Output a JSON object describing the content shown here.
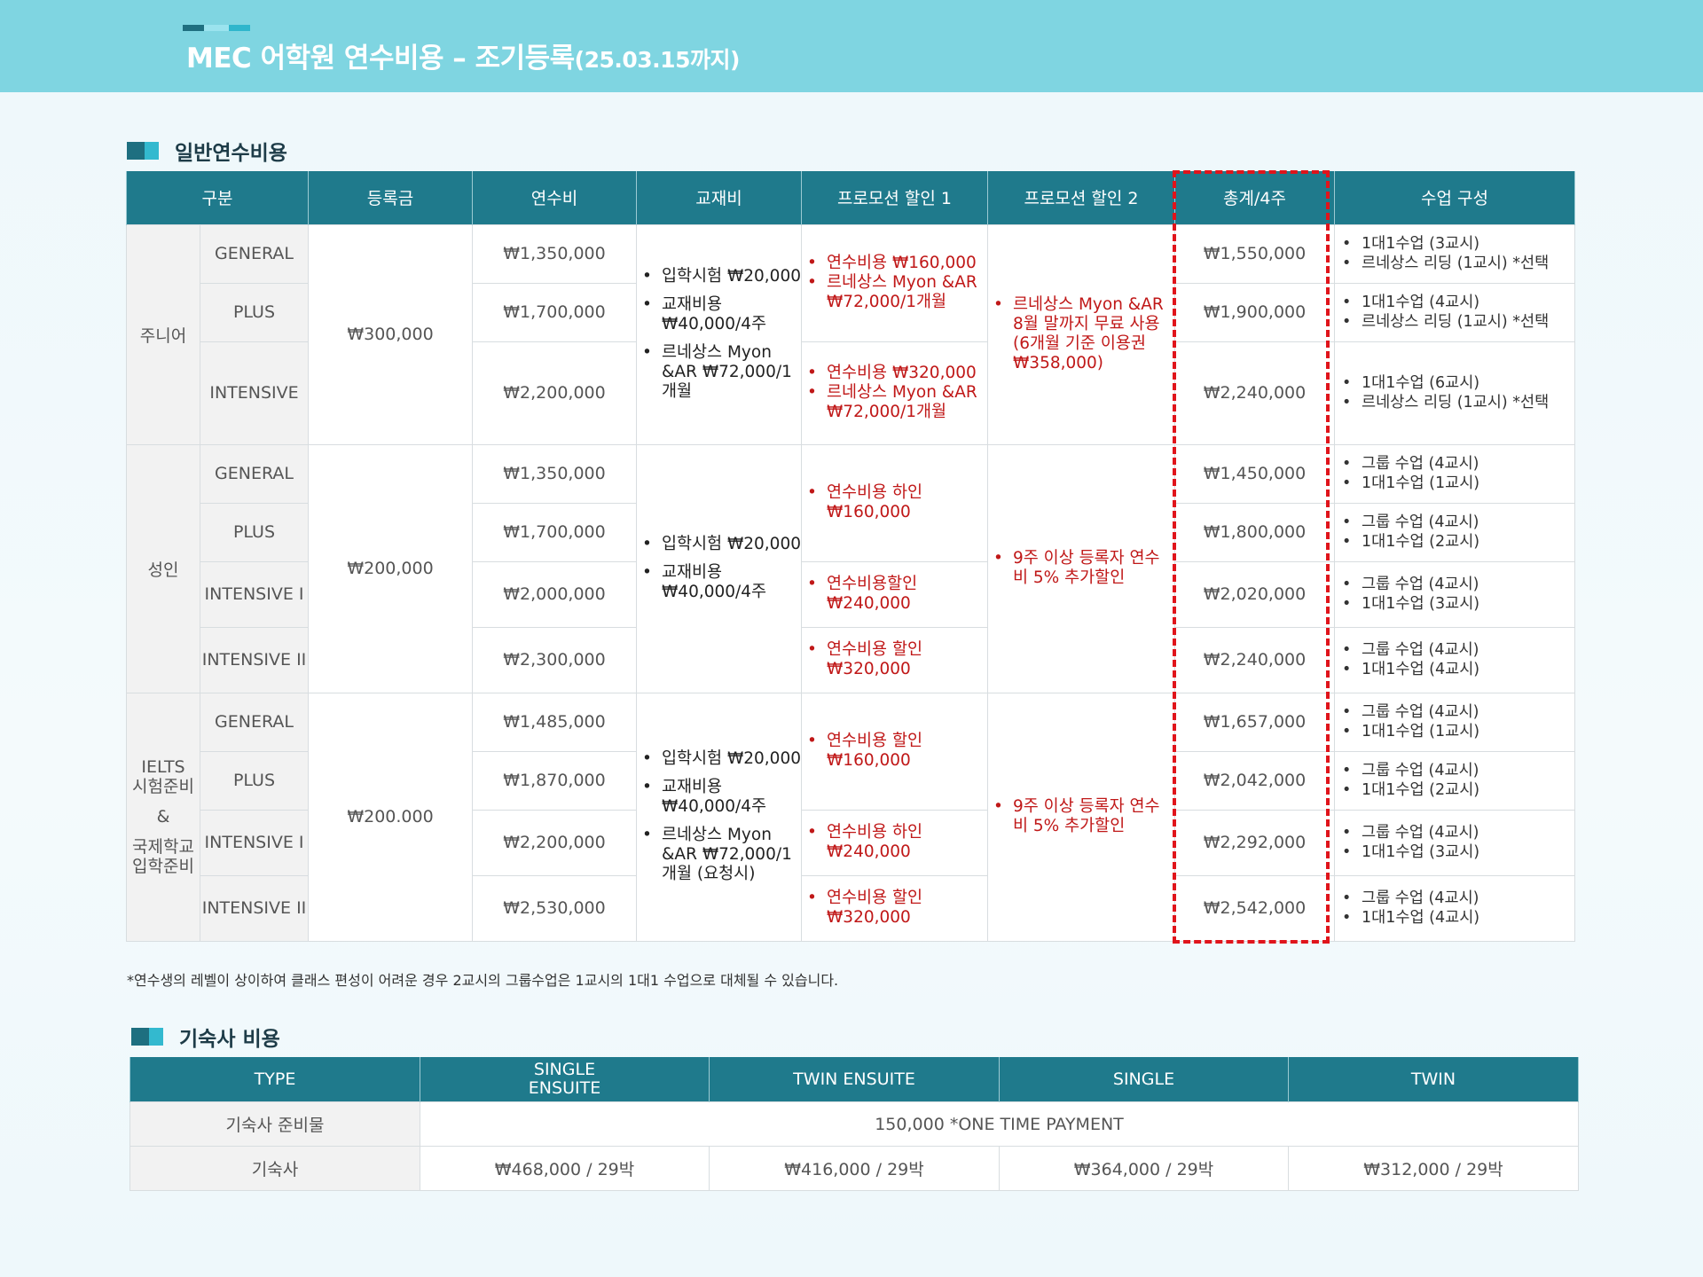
{
  "header": {
    "title_main": "MEC 어학원 연수비용 – 조기등록",
    "title_small": "(25.03.15까지)"
  },
  "colors": {
    "header_band": "#7fd5e1",
    "table_header": "#1f7a8c",
    "promo_text": "#c01818",
    "highlight_border": "#e0141b"
  },
  "section1": {
    "title": "일반연수비용",
    "headers": [
      "구분",
      "등록금",
      "연수비",
      "교재비",
      "프로모션 할인 1",
      "프로모션 할인 2",
      "총계/4주",
      "수업 구성"
    ],
    "groups": [
      {
        "category": "주니어",
        "registration": "₩300,000",
        "books": [
          "입학시험 ₩20,000",
          "교재비용 ₩40,000/4주",
          "르네상스 Myon &AR ₩72,000/1개월"
        ],
        "promo2": [
          "르네상스 Myon &AR 8월 말까지 무료 사용 (6개월 기준 이용권 ₩358,000)"
        ],
        "rows": [
          {
            "level": "GENERAL",
            "tuition": "₩1,350,000",
            "total": "₩1,550,000",
            "classes": [
              "1대1수업 (3교시)",
              "르네상스 리딩 (1교시) *선택"
            ]
          },
          {
            "level": "PLUS",
            "tuition": "₩1,700,000",
            "total": "₩1,900,000",
            "classes": [
              "1대1수업 (4교시)",
              "르네상스 리딩 (1교시) *선택"
            ]
          },
          {
            "level": "INTENSIVE",
            "tuition": "₩2,200,000",
            "total": "₩2,240,000",
            "classes": [
              "1대1수업 (6교시)",
              "르네상스 리딩 (1교시) *선택"
            ]
          }
        ],
        "promo1": [
          [
            "연수비용 ₩160,000",
            "르네상스 Myon &AR ₩72,000/1개월"
          ],
          [
            "연수비용 ₩320,000",
            "르네상스 Myon &AR ₩72,000/1개월"
          ]
        ]
      },
      {
        "category": "성인",
        "registration": "₩200,000",
        "books": [
          "입학시험 ₩20,000",
          "교재비용 ₩40,000/4주"
        ],
        "promo2": [
          "9주 이상 등록자 연수비 5% 추가할인"
        ],
        "rows": [
          {
            "level": "GENERAL",
            "tuition": "₩1,350,000",
            "total": "₩1,450,000",
            "classes": [
              "그룹 수업 (4교시)",
              "1대1수업 (1교시)"
            ]
          },
          {
            "level": "PLUS",
            "tuition": "₩1,700,000",
            "total": "₩1,800,000",
            "classes": [
              "그룹 수업 (4교시)",
              "1대1수업 (2교시)"
            ]
          },
          {
            "level": "INTENSIVE I",
            "tuition": "₩2,000,000",
            "total": "₩2,020,000",
            "classes": [
              "그룹 수업 (4교시)",
              "1대1수업 (3교시)"
            ]
          },
          {
            "level": "INTENSIVE II",
            "tuition": "₩2,300,000",
            "total": "₩2,240,000",
            "classes": [
              "그룹 수업 (4교시)",
              "1대1수업 (4교시)"
            ]
          }
        ],
        "promo1": [
          [
            "연수비용 하인 ₩160,000"
          ],
          [
            "연수비용할인 ₩240,000"
          ],
          [
            "연수비용 할인 ₩320,000"
          ]
        ]
      },
      {
        "category_lines": [
          "IELTS",
          "시험준비",
          "&",
          "국제학교",
          "입학준비"
        ],
        "registration": "₩200.000",
        "books": [
          "입학시험 ₩20,000",
          "교재비용 ₩40,000/4주",
          "르네상스 Myon &AR ₩72,000/1개월 (요청시)"
        ],
        "promo2": [
          "9주 이상 등록자 연수비 5% 추가할인"
        ],
        "rows": [
          {
            "level": "GENERAL",
            "tuition": "₩1,485,000",
            "total": "₩1,657,000",
            "classes": [
              "그룹 수업 (4교시)",
              "1대1수업 (1교시)"
            ]
          },
          {
            "level": "PLUS",
            "tuition": "₩1,870,000",
            "total": "₩2,042,000",
            "classes": [
              "그룹 수업 (4교시)",
              "1대1수업 (2교시)"
            ]
          },
          {
            "level": "INTENSIVE I",
            "tuition": "₩2,200,000",
            "total": "₩2,292,000",
            "classes": [
              "그룹 수업 (4교시)",
              "1대1수업 (3교시)"
            ]
          },
          {
            "level": "INTENSIVE II",
            "tuition": "₩2,530,000",
            "total": "₩2,542,000",
            "classes": [
              "그룹 수업 (4교시)",
              "1대1수업 (4교시)"
            ]
          }
        ],
        "promo1": [
          [
            "연수비용 할인 ₩160,000"
          ],
          [
            "연수비용 하인 ₩240,000"
          ],
          [
            "연수비용 할인 ₩320,000"
          ]
        ]
      }
    ]
  },
  "footnote": "*연수생의 레벨이 상이하여 클래스 편성이 어려운 경우 2교시의 그룹수업은 1교시의 1대1 수업으로 대체될 수 있습니다.",
  "section2": {
    "title": "기숙사 비용",
    "headers": [
      "TYPE",
      "SINGLE ENSUITE",
      "TWIN ENSUITE",
      "SINGLE",
      "TWIN"
    ],
    "prep_label": "기숙사 준비물",
    "prep_value": "150,000 *ONE TIME PAYMENT",
    "dorm_label": "기숙사",
    "dorm_prices": [
      "₩468,000 / 29박",
      "₩416,000 / 29박",
      "₩364,000 / 29박",
      "₩312,000 / 29박"
    ]
  }
}
